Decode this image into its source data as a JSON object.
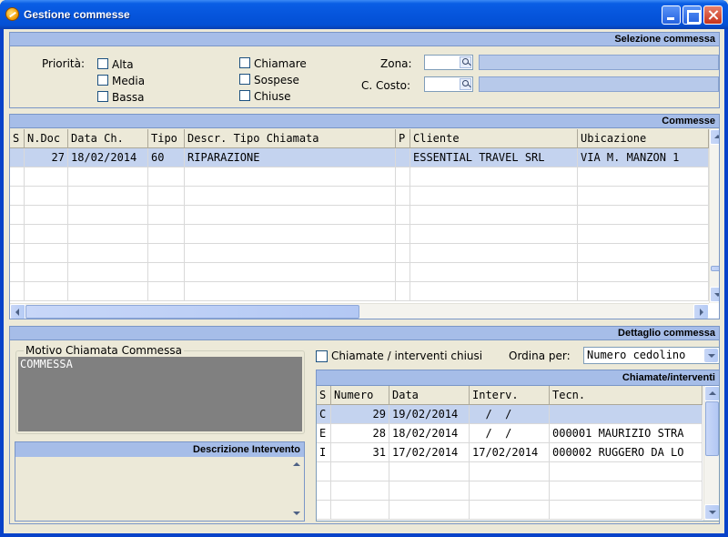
{
  "window": {
    "title": "Gestione commesse"
  },
  "selezione": {
    "header": "Selezione commessa",
    "priorita_label": "Priorità:",
    "priorita": [
      "Alta",
      "Media",
      "Bassa"
    ],
    "stati": [
      "Chiamare",
      "Sospese",
      "Chiuse"
    ],
    "zona_label": "Zona:",
    "costo_label": "C. Costo:"
  },
  "commesse": {
    "header": "Commesse",
    "columns": [
      "S",
      "N.Doc",
      "Data Ch.",
      "Tipo",
      "Descr. Tipo Chiamata",
      "P",
      "Cliente",
      "Ubicazione"
    ],
    "rows": [
      {
        "s": "",
        "ndoc": "27",
        "data": "18/02/2014",
        "tipo": "60",
        "descr": "RIPARAZIONE",
        "p": "",
        "cliente": "ESSENTIAL TRAVEL SRL",
        "ubicazione": "VIA M. MANZON 1"
      }
    ]
  },
  "dettaglio": {
    "header": "Dettaglio commessa",
    "motivo_title": "Motivo Chiamata Commessa",
    "motivo_text": "COMMESSA",
    "descr_intervento_header": "Descrizione Intervento",
    "chiusi_label": "Chiamate / interventi chiusi",
    "ordina_label": "Ordina per:",
    "ordina_value": "Numero cedolino",
    "chiamate_header": "Chiamate/interventi",
    "columns": [
      "S",
      "Numero",
      "Data",
      "Interv.",
      "Tecn."
    ],
    "rows": [
      {
        "s": "C",
        "numero": "29",
        "data": "19/02/2014",
        "interv": "  /  /",
        "tecn": ""
      },
      {
        "s": "E",
        "numero": "28",
        "data": "18/02/2014",
        "interv": "  /  /",
        "tecn": "000001 MAURIZIO STRA"
      },
      {
        "s": "I",
        "numero": "31",
        "data": "17/02/2014",
        "interv": "17/02/2014",
        "tecn": "000002 RUGGERO DA LO"
      }
    ]
  }
}
